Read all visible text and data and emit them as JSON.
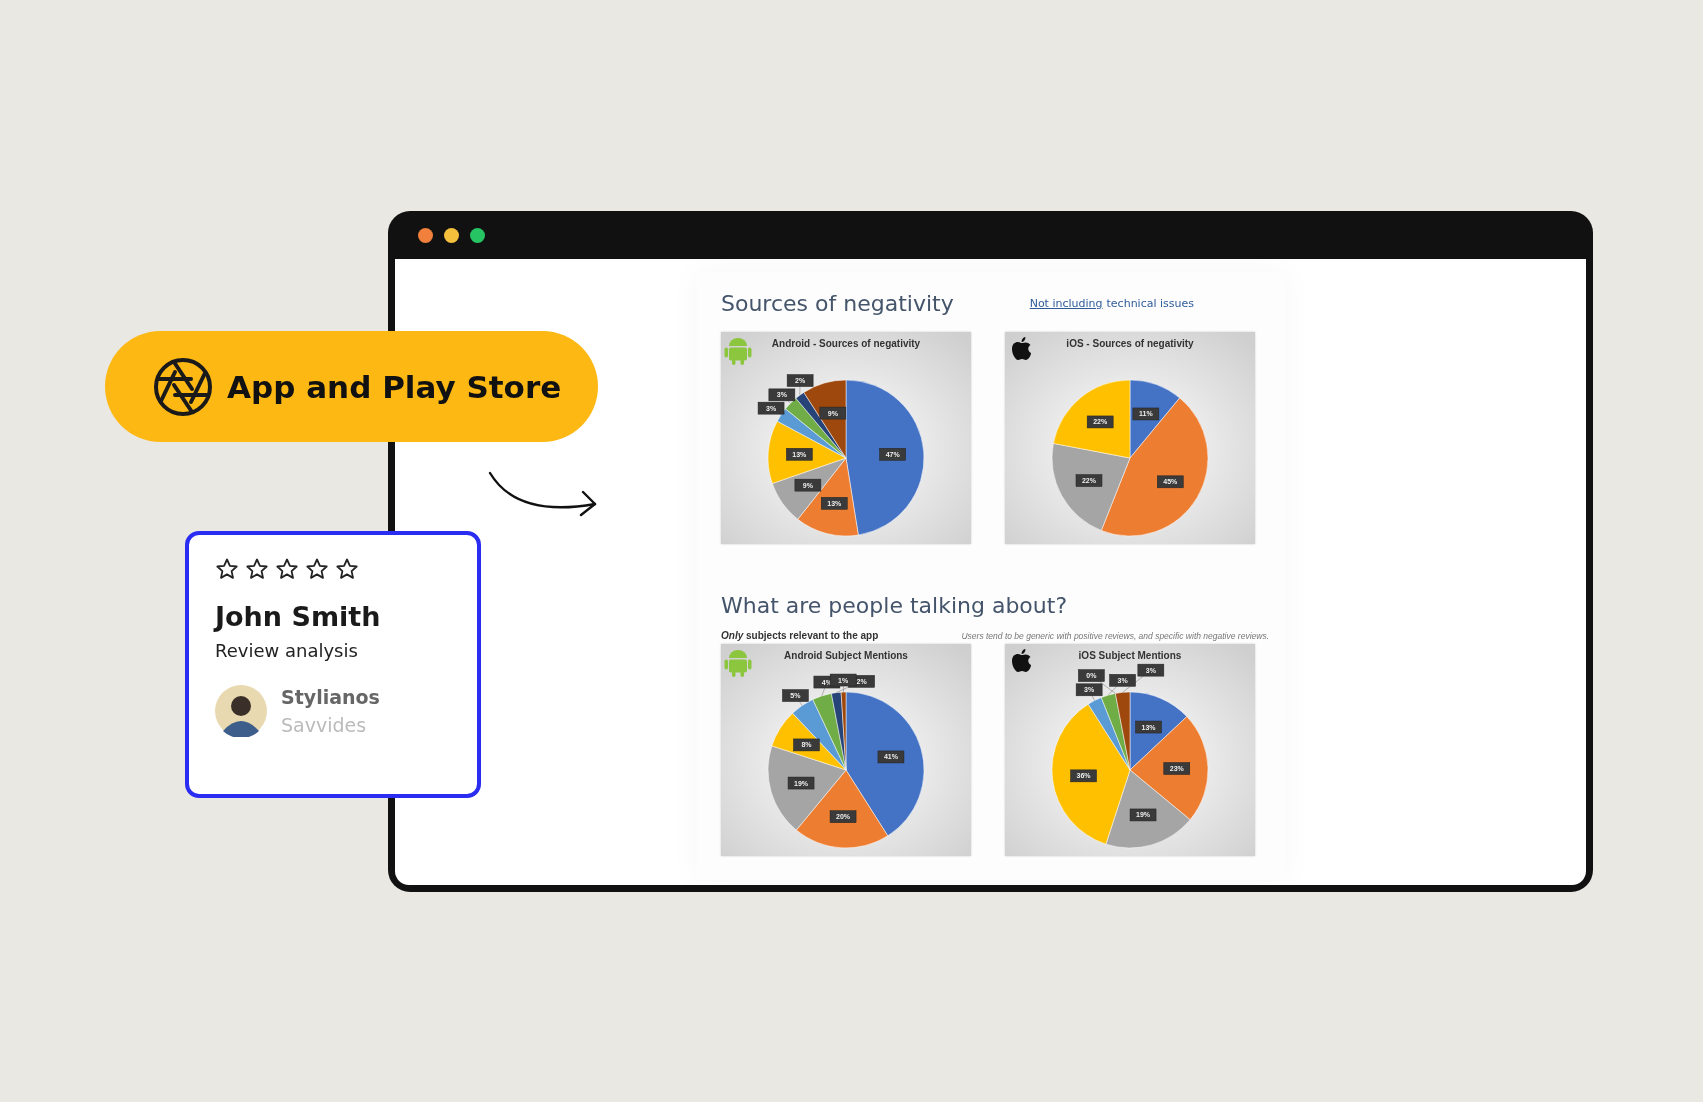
{
  "badge": {
    "label": "App and Play Store"
  },
  "review_card": {
    "stars": 0,
    "name": "John Smith",
    "subtitle": "Review analysis",
    "author_first": "Stylianos",
    "author_last": "Savvides"
  },
  "document": {
    "sections": [
      {
        "heading": "Sources of negativity",
        "note_link": "Not including",
        "note_text": "technical issues",
        "charts": [
          {
            "kind": "android",
            "chart_data": {
              "type": "pie",
              "title": "Android - Sources of negativity",
              "values": [
                47,
                13,
                9,
                13,
                3,
                3,
                2,
                9
              ],
              "value_labels": [
                "47%",
                "13%",
                "9%",
                "13%",
                "3%",
                "3%",
                "2%",
                "9%"
              ]
            }
          },
          {
            "kind": "ios",
            "chart_data": {
              "type": "pie",
              "title": "iOS - Sources of negativity",
              "values": [
                11,
                45,
                22,
                22
              ],
              "value_labels": [
                "11%",
                "45%",
                "22%",
                "22%"
              ]
            }
          }
        ]
      },
      {
        "heading": "What are people talking about?",
        "subtitle": "*Only* subjects relevant to the app",
        "remark": "Users tend to be generic with positive reviews, and specific with negative reviews.",
        "charts": [
          {
            "kind": "android",
            "chart_data": {
              "type": "pie",
              "title": "Android Subject Mentions",
              "values": [
                41,
                20,
                19,
                8,
                5,
                4,
                2,
                1
              ],
              "value_labels": [
                "41%",
                "20%",
                "19%",
                "8%",
                "5%",
                "4%",
                "2%",
                "1%"
              ]
            }
          },
          {
            "kind": "ios",
            "chart_data": {
              "type": "pie",
              "title": "iOS Subject Mentions",
              "values": [
                13,
                23,
                19,
                36,
                3,
                3,
                0,
                3
              ],
              "value_labels": [
                "13%",
                "23%",
                "19%",
                "36%",
                "3%",
                "3%",
                "0%",
                "3%"
              ]
            }
          }
        ]
      }
    ]
  }
}
